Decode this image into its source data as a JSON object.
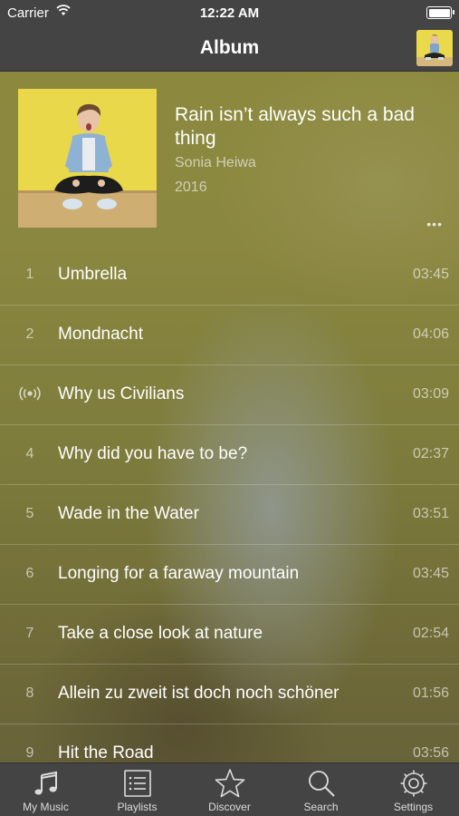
{
  "status_bar": {
    "carrier": "Carrier",
    "time": "12:22 AM"
  },
  "nav": {
    "title": "Album"
  },
  "album": {
    "title": "Rain isn’t always such a bad thing",
    "artist": "Sonia Heiwa",
    "year": "2016",
    "more_icon": "•••"
  },
  "tracks": [
    {
      "number": "1",
      "title": "Umbrella",
      "duration": "03:45"
    },
    {
      "number": "2",
      "title": "Mondnacht",
      "duration": "04:06"
    },
    {
      "number": "",
      "icon": "now-playing-icon",
      "title": "Why us Civilians",
      "duration": "03:09"
    },
    {
      "number": "4",
      "title": "Why did you have to be?",
      "duration": "02:37"
    },
    {
      "number": "5",
      "title": "Wade in the Water",
      "duration": "03:51"
    },
    {
      "number": "6",
      "title": "Longing for a faraway mountain",
      "duration": "03:45"
    },
    {
      "number": "7",
      "title": "Take a close look at nature",
      "duration": "02:54"
    },
    {
      "number": "8",
      "title": "Allein zu zweit ist doch noch schöner",
      "duration": "01:56"
    },
    {
      "number": "9",
      "title": "Hit the Road",
      "duration": "03:56"
    }
  ],
  "tabs": [
    {
      "label": "My Music",
      "icon": "music-note-icon"
    },
    {
      "label": "Playlists",
      "icon": "list-icon"
    },
    {
      "label": "Discover",
      "icon": "star-icon"
    },
    {
      "label": "Search",
      "icon": "search-icon"
    },
    {
      "label": "Settings",
      "icon": "gear-icon"
    }
  ],
  "colors": {
    "bar_background": "#444444",
    "background_tint": "#8a8740",
    "cover_yellow": "#e8d94a"
  }
}
